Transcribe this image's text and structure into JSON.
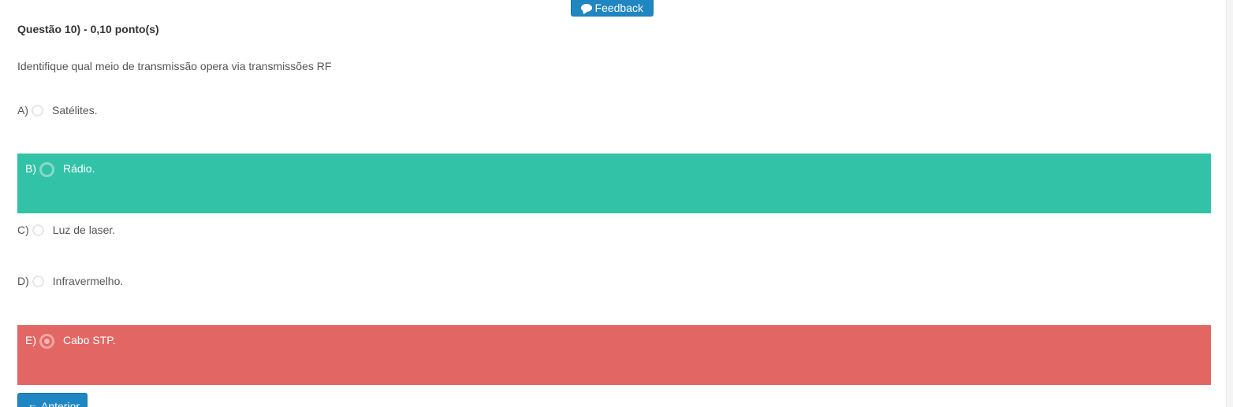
{
  "feedback_button": {
    "label": "Feedback",
    "icon": "comment-icon"
  },
  "question": {
    "title": "Questão 10) - 0,10 ponto(s)",
    "text": "Identifique qual meio de transmissão opera via transmissões RF"
  },
  "options": [
    {
      "letter": "A)",
      "label": "Satélites.",
      "state": "default"
    },
    {
      "letter": "B)",
      "label": "Rádio.",
      "state": "correct"
    },
    {
      "letter": "C)",
      "label": "Luz de laser.",
      "state": "default"
    },
    {
      "letter": "D)",
      "label": "Infravermelho.",
      "state": "default"
    },
    {
      "letter": "E)",
      "label": "Cabo STP.",
      "state": "wrong-selected"
    }
  ],
  "colors": {
    "correct": "#32c2a7",
    "wrong": "#e26764",
    "button": "#1f86c2"
  },
  "prev_button": {
    "label": "Anterior",
    "icon": "arrow-left-icon"
  }
}
